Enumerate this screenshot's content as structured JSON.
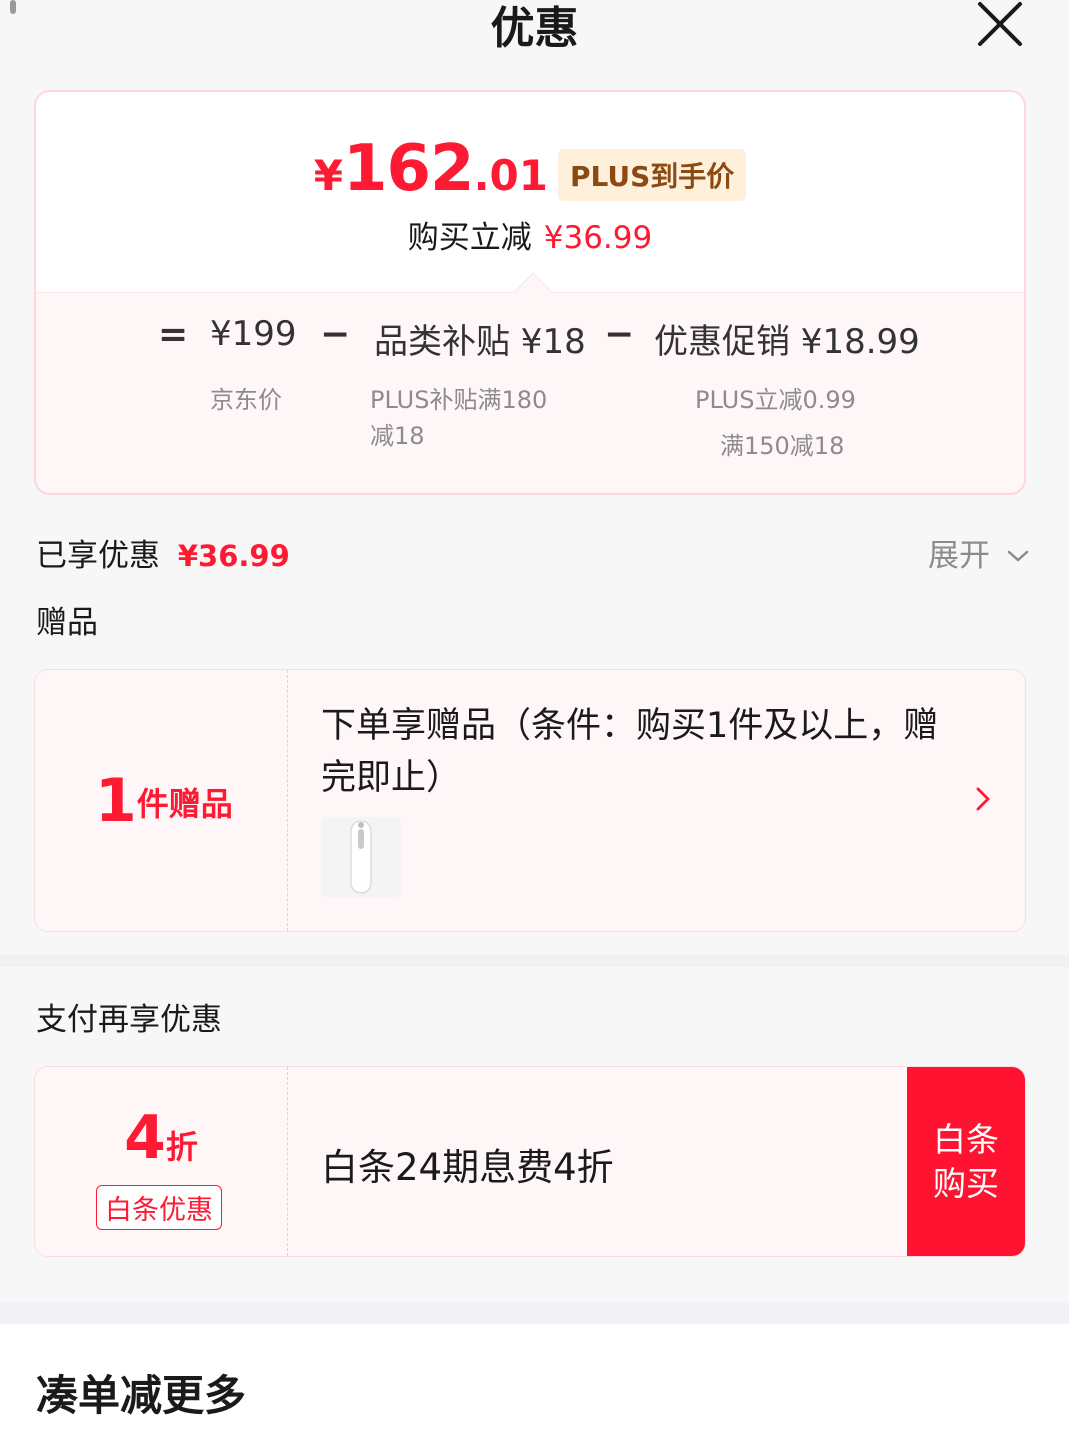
{
  "header": {
    "title": "优惠"
  },
  "price_card": {
    "currency": "¥",
    "price_int": "162",
    "price_dec": ".01",
    "plus_tag": "PLUS到手价",
    "save_label": "购买立减",
    "save_amount": "¥36.99",
    "breakdown": {
      "equals": "=",
      "minus": "−",
      "jd_price": "¥199",
      "jd_price_label": "京东价",
      "subsidy": "品类补贴 ¥18",
      "subsidy_desc_1": "PLUS补贴满180",
      "subsidy_desc_2": "减18",
      "promo": "优惠促销 ¥18.99",
      "promo_desc_1": "PLUS立减0.99",
      "promo_desc_2": "满150减18"
    }
  },
  "enjoyed": {
    "label": "已享优惠",
    "amount": "¥36.99",
    "expand_label": "展开"
  },
  "gift_section": {
    "title": "赠品",
    "count": "1",
    "count_unit": "件赠品",
    "desc": "下单享赠品（条件：购买1件及以上，赠完即止）"
  },
  "pay_section": {
    "title": "支付再享优惠",
    "discount_num": "4",
    "discount_unit": "折",
    "tag": "白条优惠",
    "desc": "白条24期息费4折",
    "button_line1": "白条",
    "button_line2": "购买"
  },
  "bottom_section": {
    "title": "凑单减更多"
  },
  "colors": {
    "accent": "#ff1a33",
    "plus_bg": "#fff0dc",
    "plus_text": "#8a4a12"
  },
  "icons": {
    "close": "close-icon",
    "chevron_down": "chevron-down-icon",
    "chevron_right": "chevron-right-icon"
  }
}
